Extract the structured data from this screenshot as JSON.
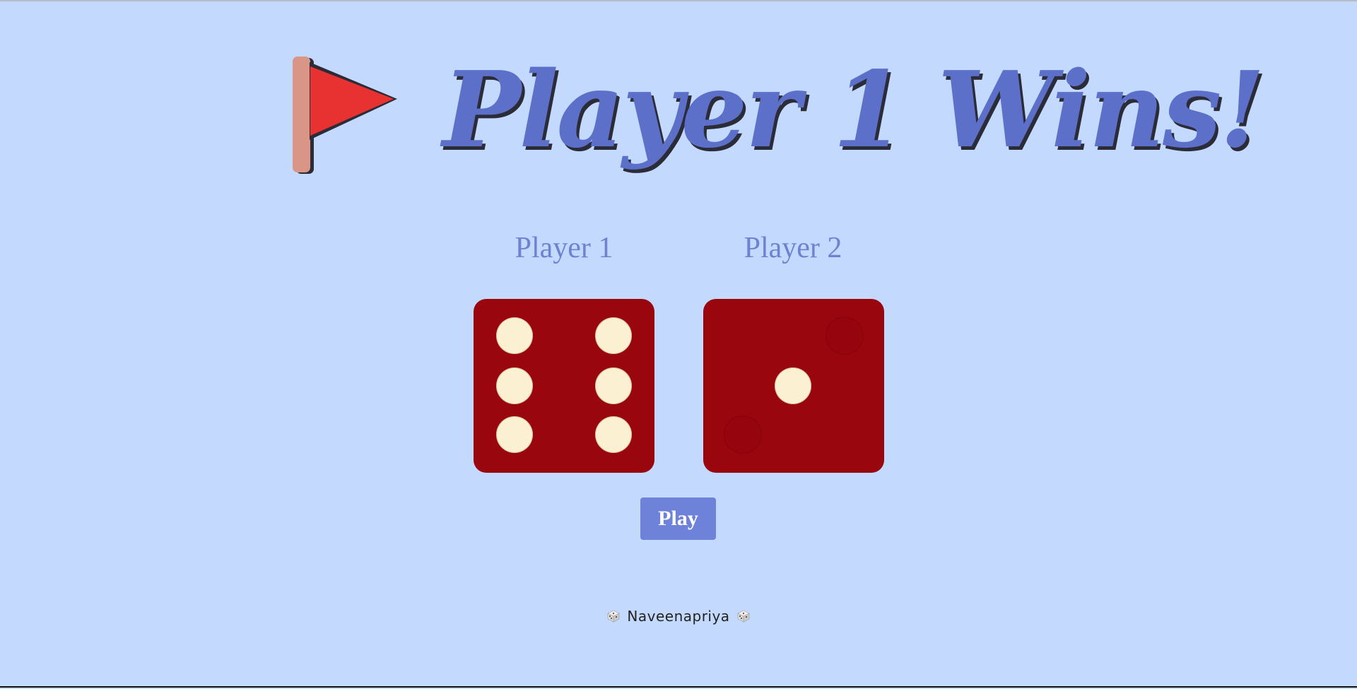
{
  "result": {
    "title": "Player 1 Wins!",
    "icon": "red-flag-icon"
  },
  "players": [
    {
      "label": "Player 1",
      "die_value": 6
    },
    {
      "label": "Player 2",
      "die_value": 1
    }
  ],
  "controls": {
    "play_label": "Play"
  },
  "footer": {
    "author": "Naveenapriya",
    "icon": "dice-icon"
  },
  "colors": {
    "background": "#c3dafe",
    "title": "#5c6fc9",
    "label": "#6f82d2",
    "die_face": "#9a060e",
    "pip": "#fbf0d2",
    "button": "#6d82d8",
    "flag": "#e83232"
  }
}
